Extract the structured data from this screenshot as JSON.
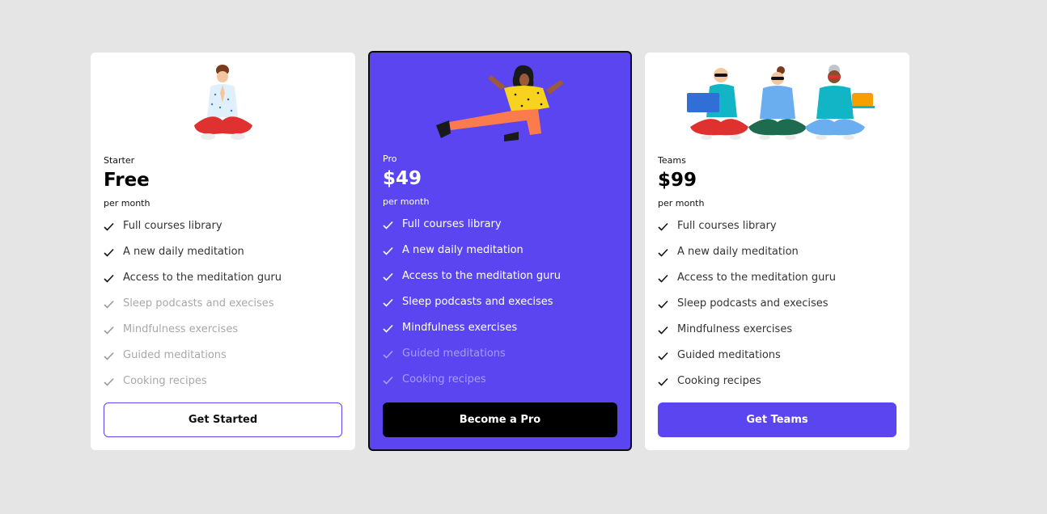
{
  "plans": [
    {
      "tier": "Starter",
      "price": "Free",
      "period": "per month",
      "features": [
        {
          "label": "Full courses library",
          "included": true
        },
        {
          "label": "A new daily meditation",
          "included": true
        },
        {
          "label": "Access to the meditation guru",
          "included": true
        },
        {
          "label": "Sleep podcasts and execises",
          "included": false
        },
        {
          "label": "Mindfulness exercises",
          "included": false
        },
        {
          "label": "Guided meditations",
          "included": false
        },
        {
          "label": "Cooking recipes",
          "included": false
        }
      ],
      "button_label": "Get Started"
    },
    {
      "tier": "Pro",
      "price": "$49",
      "period": "per month",
      "features": [
        {
          "label": "Full courses library",
          "included": true
        },
        {
          "label": "A new daily meditation",
          "included": true
        },
        {
          "label": "Access to the meditation guru",
          "included": true
        },
        {
          "label": "Sleep podcasts and execises",
          "included": true
        },
        {
          "label": "Mindfulness exercises",
          "included": true
        },
        {
          "label": "Guided meditations",
          "included": false
        },
        {
          "label": "Cooking recipes",
          "included": false
        }
      ],
      "button_label": "Become a Pro"
    },
    {
      "tier": "Teams",
      "price": "$99",
      "period": "per month",
      "features": [
        {
          "label": "Full courses library",
          "included": true
        },
        {
          "label": "A new daily meditation",
          "included": true
        },
        {
          "label": "Access to the meditation guru",
          "included": true
        },
        {
          "label": "Sleep podcasts and execises",
          "included": true
        },
        {
          "label": "Mindfulness exercises",
          "included": true
        },
        {
          "label": "Guided meditations",
          "included": true
        },
        {
          "label": "Cooking recipes",
          "included": true
        }
      ],
      "button_label": "Get Teams"
    }
  ],
  "colors": {
    "accent": "#5b45f0",
    "background": "#e5e5e5",
    "card": "#ffffff"
  },
  "icons": {
    "check": "check-icon",
    "starter_illustration": "meditating-person-illustration",
    "pro_illustration": "floating-person-illustration",
    "teams_illustration": "meditating-group-illustration"
  }
}
